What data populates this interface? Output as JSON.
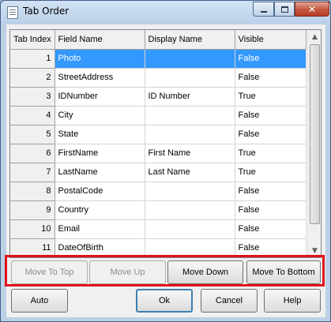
{
  "window": {
    "title": "Tab Order"
  },
  "grid": {
    "columns": [
      "Tab Index",
      "Field Name",
      "Display Name",
      "Visible"
    ],
    "rows": [
      {
        "index": "1",
        "field": "Photo",
        "display": "",
        "visible": "False",
        "selected": true
      },
      {
        "index": "2",
        "field": "StreetAddress",
        "display": "",
        "visible": "False"
      },
      {
        "index": "3",
        "field": "IDNumber",
        "display": "ID Number",
        "visible": "True"
      },
      {
        "index": "4",
        "field": "City",
        "display": "",
        "visible": "False"
      },
      {
        "index": "5",
        "field": "State",
        "display": "",
        "visible": "False"
      },
      {
        "index": "6",
        "field": "FirstName",
        "display": "First Name",
        "visible": "True"
      },
      {
        "index": "7",
        "field": "LastName",
        "display": "Last Name",
        "visible": "True"
      },
      {
        "index": "8",
        "field": "PostalCode",
        "display": "",
        "visible": "False"
      },
      {
        "index": "9",
        "field": "Country",
        "display": "",
        "visible": "False"
      },
      {
        "index": "10",
        "field": "Email",
        "display": "",
        "visible": "False"
      },
      {
        "index": "11",
        "field": "DateOfBirth",
        "display": "",
        "visible": "False"
      }
    ]
  },
  "move_buttons": {
    "move_to_top": "Move To Top",
    "move_up": "Move Up",
    "move_down": "Move Down",
    "move_to_bottom": "Move To Bottom"
  },
  "dialog_buttons": {
    "auto": "Auto",
    "ok": "Ok",
    "cancel": "Cancel",
    "help": "Help"
  },
  "colors": {
    "selection": "#3399ff",
    "highlight_box": "#e0101a"
  }
}
